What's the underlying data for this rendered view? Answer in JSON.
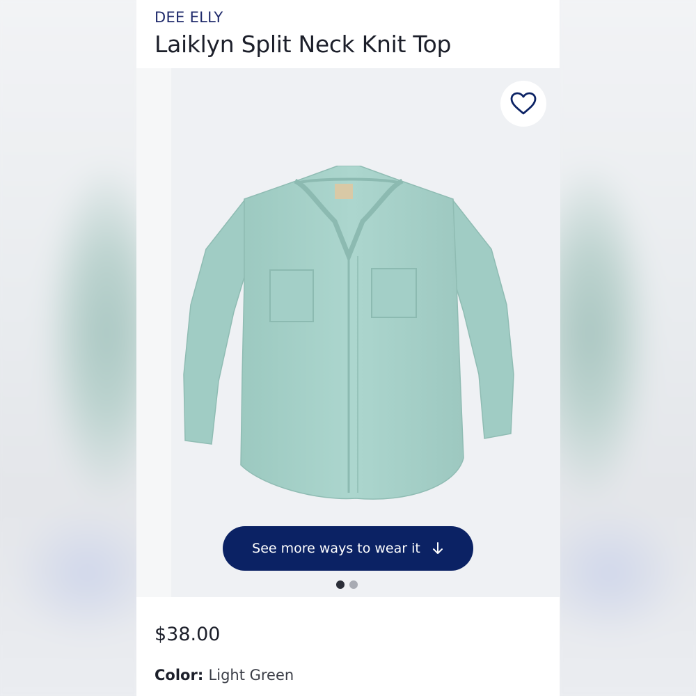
{
  "product": {
    "brand": "DEE ELLY",
    "title": "Laiklyn Split Neck Knit Top",
    "price": "$38.00",
    "color_label": "Color:",
    "color_value": "Light Green"
  },
  "gallery": {
    "cta_label": "See more ways to wear it",
    "cta_icon": "arrow-down-icon",
    "favorite_icon": "heart-outline-icon",
    "slide_count": 2,
    "active_slide": 1
  },
  "colors": {
    "brand_navy": "#0b2264",
    "garment": "#a9d3cb",
    "title_text": "#1c1f2a",
    "brand_text": "#1f2a6b"
  }
}
